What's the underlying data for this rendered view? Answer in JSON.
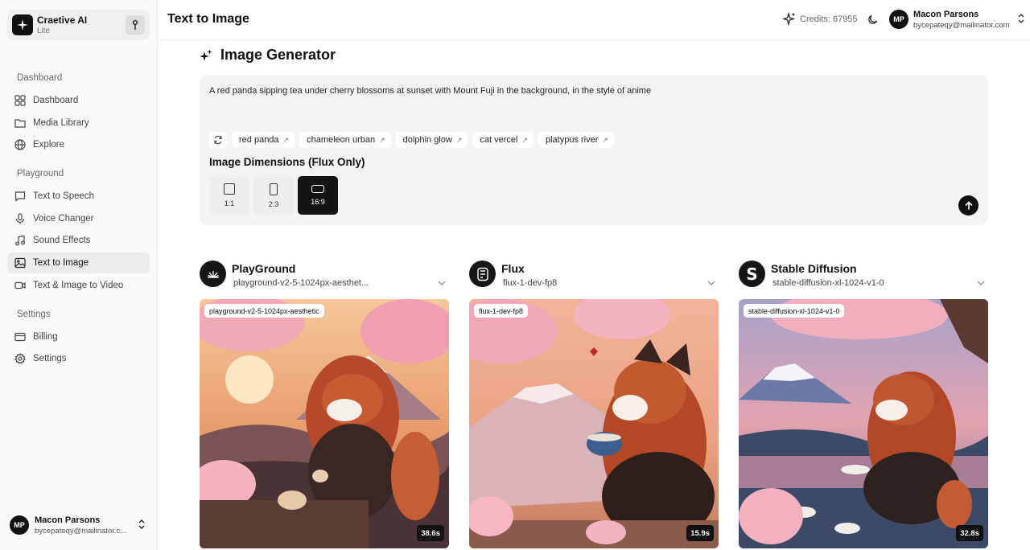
{
  "app": {
    "name": "Craetive AI",
    "plan": "Lite"
  },
  "sidebar": {
    "sections": [
      {
        "label": "Dashboard",
        "items": [
          {
            "label": "Dashboard",
            "icon": "dashboard-icon"
          },
          {
            "label": "Media Library",
            "icon": "folder-icon"
          },
          {
            "label": "Explore",
            "icon": "globe-icon"
          }
        ]
      },
      {
        "label": "Playground",
        "items": [
          {
            "label": "Text to Speech",
            "icon": "speech-bubble-icon"
          },
          {
            "label": "Voice Changer",
            "icon": "microphone-icon"
          },
          {
            "label": "Sound Effects",
            "icon": "music-note-icon"
          },
          {
            "label": "Text to Image",
            "icon": "image-icon",
            "active": true
          },
          {
            "label": "Text & Image to Video",
            "icon": "video-icon"
          }
        ]
      },
      {
        "label": "Settings",
        "items": [
          {
            "label": "Billing",
            "icon": "credit-card-icon"
          },
          {
            "label": "Settings",
            "icon": "gear-icon"
          }
        ]
      }
    ]
  },
  "user": {
    "initials": "MP",
    "name": "Macon Parsons",
    "email": "bycepateqy@mailinator.com",
    "email_short": "bycepateqy@mailinator.c..."
  },
  "header": {
    "title": "Text to Image",
    "credits_label": "Credits: 67955"
  },
  "generator": {
    "title": "Image Generator",
    "prompt": "A red panda sipping tea under cherry blossoms at sunset with Mount Fuji in the background, in the style of anime",
    "suggestions": [
      "red panda",
      "chameleon urban",
      "dolphin glow",
      "cat vercel",
      "platypus river"
    ],
    "dimensions_label": "Image Dimensions (Flux Only)",
    "dimensions": [
      {
        "label": "1:1",
        "active": false
      },
      {
        "label": "2:3",
        "active": false
      },
      {
        "label": "16:9",
        "active": true
      }
    ]
  },
  "models": [
    {
      "name": "PlayGround",
      "selected": "playground-v2-5-1024px-aesthet...",
      "tag": "playground-v2-5-1024px-aesthetic",
      "time": "38.6s"
    },
    {
      "name": "Flux",
      "selected": "flux-1-dev-fp8",
      "tag": "flux-1-dev-fp8",
      "time": "15.9s"
    },
    {
      "name": "Stable Diffusion",
      "selected": "stable-diffusion-xl-1024-v1-0",
      "tag": "stable-diffusion-xl-1024-v1-0",
      "time": "32.8s"
    }
  ],
  "colors": {
    "accent": "#111111",
    "panel": "#f4f4f4",
    "sidebar": "#fafafa"
  }
}
